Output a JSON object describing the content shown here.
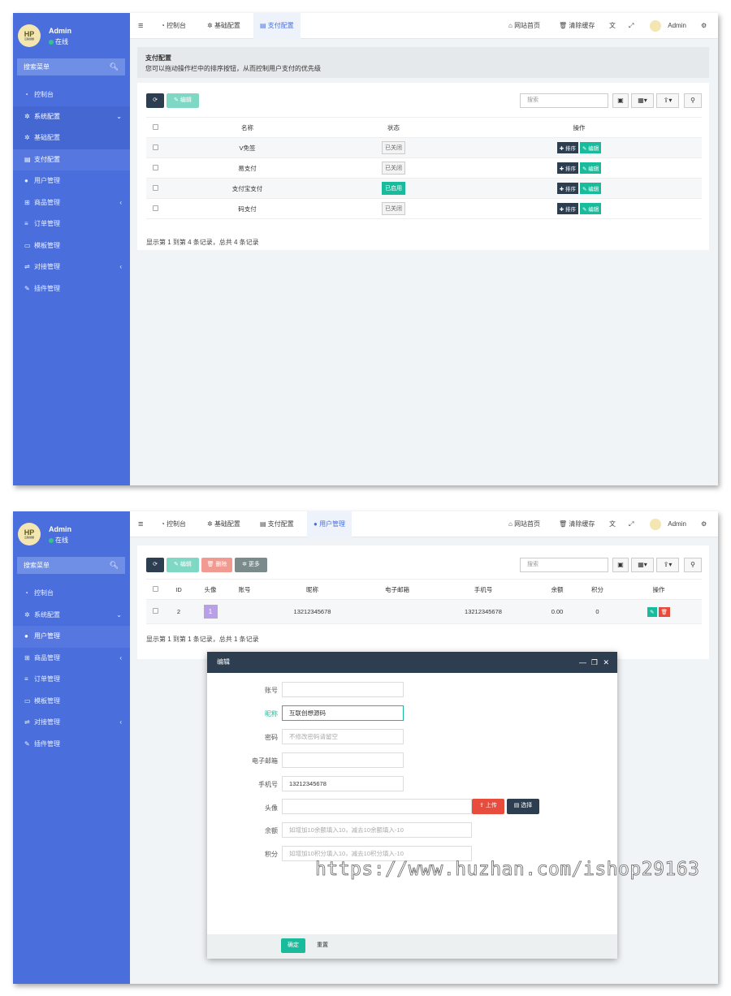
{
  "screen1": {
    "sidebar": {
      "avatar_text": "HP",
      "avatar_sub": "互联创想",
      "user_name": "Admin",
      "user_status": "在线",
      "search_placeholder": "搜索菜单",
      "items": [
        {
          "icon": "dashboard-icon",
          "label": "控制台"
        },
        {
          "icon": "gear-icon",
          "label": "系统配置",
          "arrow": "⌄"
        },
        {
          "icon": "gear-icon",
          "label": "基础配置"
        },
        {
          "icon": "list-icon",
          "label": "支付配置"
        },
        {
          "icon": "user-icon",
          "label": "用户管理"
        },
        {
          "icon": "cart-icon",
          "label": "商品管理",
          "arrow": "‹"
        },
        {
          "icon": "bars-icon",
          "label": "订单管理"
        },
        {
          "icon": "template-icon",
          "label": "模板管理"
        },
        {
          "icon": "sliders-icon",
          "label": "对接管理",
          "arrow": "‹"
        },
        {
          "icon": "plug-icon",
          "label": "插件管理"
        }
      ]
    },
    "topbar": {
      "menu_icon": "≡",
      "tabs": [
        "控制台",
        "基础配置",
        "支付配置"
      ],
      "right": [
        "网站首页",
        "清除缓存",
        "Admin"
      ]
    },
    "tip": {
      "title": "支付配置",
      "text": "您可以拖动操作栏中的排序按钮，从而控制用户支付的优先级"
    },
    "toolbar": {
      "edit_label": "编辑",
      "search_placeholder": "搜索"
    },
    "table": {
      "headers": [
        "名称",
        "状态",
        "操作"
      ],
      "rows": [
        {
          "name": "V免签",
          "status": "已关闭",
          "on": false
        },
        {
          "name": "易支付",
          "status": "已关闭",
          "on": false
        },
        {
          "name": "支付宝支付",
          "status": "已启用",
          "on": true
        },
        {
          "name": "码支付",
          "status": "已关闭",
          "on": false
        }
      ],
      "op_sort": "排序",
      "op_edit": "编辑"
    },
    "footer": "显示第 1 到第 4 条记录，总共 4 条记录"
  },
  "screen2": {
    "sidebar": {
      "avatar_text": "HP",
      "avatar_sub": "互联创想",
      "user_name": "Admin",
      "user_status": "在线",
      "search_placeholder": "搜索菜单",
      "items": [
        {
          "icon": "dashboard-icon",
          "label": "控制台"
        },
        {
          "icon": "gear-icon",
          "label": "系统配置",
          "arrow": "⌄"
        },
        {
          "icon": "user-icon",
          "label": "用户管理"
        },
        {
          "icon": "cart-icon",
          "label": "商品管理",
          "arrow": "‹"
        },
        {
          "icon": "bars-icon",
          "label": "订单管理"
        },
        {
          "icon": "template-icon",
          "label": "模板管理"
        },
        {
          "icon": "sliders-icon",
          "label": "对接管理",
          "arrow": "‹"
        },
        {
          "icon": "plug-icon",
          "label": "插件管理"
        }
      ]
    },
    "topbar": {
      "tabs": [
        "控制台",
        "基础配置",
        "支付配置",
        "用户管理"
      ],
      "right": [
        "网站首页",
        "清除缓存",
        "Admin"
      ]
    },
    "toolbar": {
      "edit_label": "编辑",
      "delete_label": "删除",
      "more_label": "更多",
      "search_placeholder": "搜索"
    },
    "table": {
      "headers": [
        "ID",
        "头像",
        "账号",
        "昵称",
        "电子邮箱",
        "手机号",
        "余额",
        "积分",
        "操作"
      ],
      "row": {
        "id": "2",
        "avatar": "1",
        "account": "",
        "nickname": "13212345678",
        "email": "",
        "phone": "13212345678",
        "balance": "0.00",
        "points": "0"
      }
    },
    "footer": "显示第 1 到第 1 条记录，总共 1 条记录",
    "modal": {
      "title": "编辑",
      "fields": [
        {
          "label": "账号",
          "value": "",
          "placeholder": ""
        },
        {
          "label": "昵称",
          "value": "互联创想源码",
          "placeholder": ""
        },
        {
          "label": "密码",
          "value": "",
          "placeholder": "不修改密码请留空"
        },
        {
          "label": "电子邮箱",
          "value": "",
          "placeholder": ""
        },
        {
          "label": "手机号",
          "value": "13212345678",
          "placeholder": ""
        },
        {
          "label": "头像",
          "value": "",
          "placeholder": ""
        },
        {
          "label": "余额",
          "value": "",
          "placeholder": "如增加10余额填入10，减去10余额填入-10"
        },
        {
          "label": "积分",
          "value": "",
          "placeholder": "如增加10积分填入10，减去10积分填入-10"
        }
      ],
      "upload_label": "上传",
      "choose_label": "选择",
      "confirm_label": "确定",
      "reset_label": "重置"
    }
  },
  "watermark": "https://www.huzhan.com/ishop29163",
  "colors": {
    "sidebar": "#4a6fdc",
    "accent": "#18bc9c",
    "dark": "#2c3e50",
    "danger": "#e74c3c"
  }
}
